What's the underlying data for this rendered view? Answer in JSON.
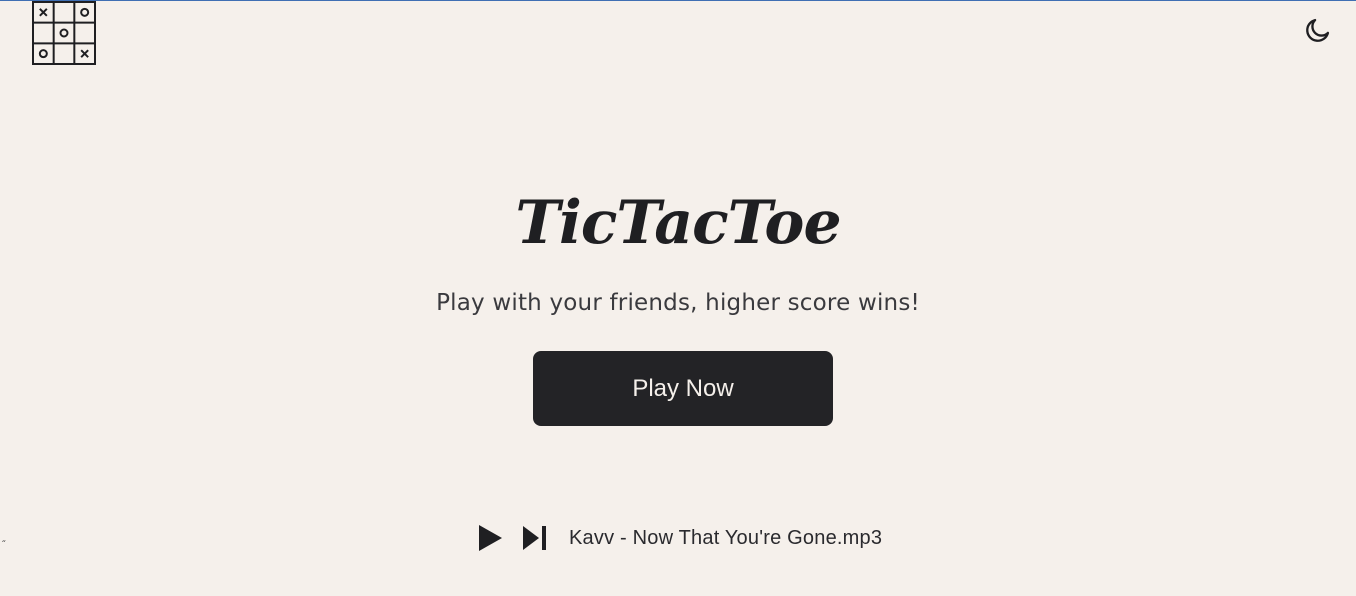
{
  "header": {
    "logo_icon": "tic-tac-toe-grid-icon",
    "logo_cells": [
      "x",
      "",
      "o",
      "",
      "o",
      "",
      "o",
      "",
      "x"
    ],
    "theme_toggle_icon": "moon-icon"
  },
  "hero": {
    "title": "TicTacToe",
    "subtitle": "Play with your friends, higher score wins!",
    "cta_label": "Play Now"
  },
  "music_player": {
    "play_icon": "play-icon",
    "next_icon": "skip-next-icon",
    "track_name": "Kavv - Now That You're Gone.mp3"
  },
  "colors": {
    "background": "#f5f0eb",
    "foreground": "#222226",
    "button_bg": "#232326",
    "button_text": "#f5f0eb"
  }
}
